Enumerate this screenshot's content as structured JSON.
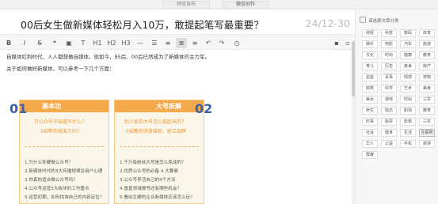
{
  "topbar": {
    "preview": "预览发布",
    "wechat": "微信创作"
  },
  "editor": {
    "title": "00后女生做新媒体轻松月入10万，敢提起笔写最重要？",
    "date": "24/12-30"
  },
  "toolbar": [
    "B",
    "I",
    "S",
    "❝",
    "▣",
    "T",
    "H1",
    "H2",
    "H3",
    "—",
    "☰",
    "≡",
    "≣",
    "≡",
    "↶",
    "↷",
    "◷"
  ],
  "content": {
    "p1": "自媒体红利时代，人人都想做自媒体。现如今，95后、00后已然成为了新媒体的主力军。",
    "p2": "关于如何做好新媒体，可以参考一下几个方面："
  },
  "card": {
    "left": {
      "num": "01",
      "header": "基本功",
      "q1": "开公众号不知道写什么？",
      "q2": "5招帮你找准方向！",
      "items": [
        "1.为什么你要做公众号？",
        "2.新媒体时代的3大传播规律及用户心理",
        "3.你真的适合做公众号吗？",
        "4.公众号运营3大板块的工作重点",
        "5.运营初期，如何找准自己的内容定位？"
      ]
    },
    "right": {
      "num": "02",
      "header": "大号拆解",
      "q1": "别人家的大号怎么做起来的？",
      "q2": "5招教你快速增粉、树立品牌",
      "items": [
        "1.千万级粉丝大号是怎么炼成的？",
        "2.优质公众号的必备 4 大要素",
        "3.公众号养活自己的4个方法",
        "4.垂直领域做号还有哪些机会？",
        "5.看似生硬的企业新媒体应该怎么玩？"
      ]
    }
  },
  "sidebar": {
    "header": "请选择文章分类",
    "tags": [
      "财经",
      "科技",
      "数码",
      "体育",
      "娱乐",
      "电影",
      "汽车",
      "旅游",
      "文化",
      "时尚",
      "健康",
      "教育",
      "育儿",
      "历史",
      "美食",
      "房产",
      "星座",
      "军事",
      "情感",
      "宠物",
      "搞笑",
      "科学",
      "艺术",
      "美食",
      "美女",
      "游戏",
      "时尚",
      "三农",
      "养生",
      "励志",
      "职场",
      "教育",
      "时事",
      "股票",
      "影像",
      "三农",
      "社会",
      "健身",
      "生活",
      "互联网",
      "华人",
      "公益",
      "手机",
      "旅游",
      "群雄"
    ],
    "selected_index": 39
  }
}
